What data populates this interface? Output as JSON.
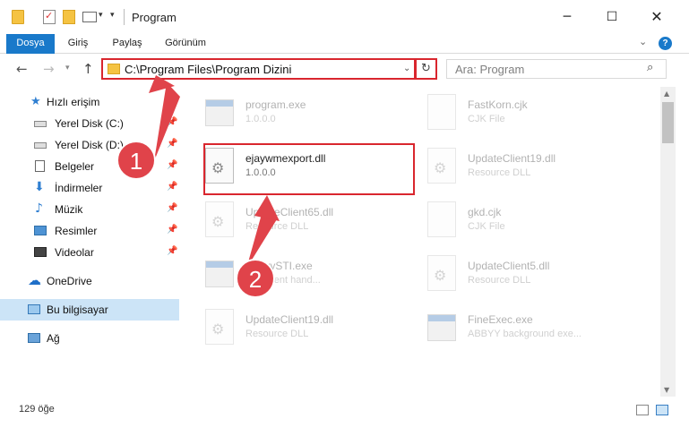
{
  "window": {
    "title": "Program",
    "minimize_glyph": "─",
    "maximize_glyph": "☐",
    "close_glyph": "✕"
  },
  "ribbon": {
    "tabs": [
      {
        "label": "Dosya",
        "active": true
      },
      {
        "label": "Giriş"
      },
      {
        "label": "Paylaş"
      },
      {
        "label": "Görünüm"
      }
    ],
    "help": "?"
  },
  "address": {
    "path": "C:\\Program Files\\Program Dizini",
    "search_placeholder": "Ara: Program"
  },
  "sidebar": {
    "items": [
      {
        "label": "Hızlı erişim",
        "icon": "star-icon"
      },
      {
        "label": "Yerel Disk (C:)",
        "icon": "disk-icon",
        "pinned": true
      },
      {
        "label": "Yerel Disk (D:)",
        "icon": "disk-icon",
        "pinned": true
      },
      {
        "label": "Belgeler",
        "icon": "document-icon",
        "pinned": true
      },
      {
        "label": "İndirmeler",
        "icon": "download-icon",
        "pinned": true
      },
      {
        "label": "Müzik",
        "icon": "music-icon",
        "pinned": true
      },
      {
        "label": "Resimler",
        "icon": "pictures-icon",
        "pinned": true
      },
      {
        "label": "Videolar",
        "icon": "videos-icon",
        "pinned": true
      },
      {
        "label": "OneDrive",
        "icon": "onedrive-icon"
      },
      {
        "label": "Bu bilgisayar",
        "icon": "computer-icon",
        "selected": true
      },
      {
        "label": "Ağ",
        "icon": "network-icon"
      }
    ]
  },
  "files": [
    {
      "name": "program.exe",
      "desc": "1.0.0.0",
      "type": "exe",
      "faded": true
    },
    {
      "name": "FastKorn.cjk",
      "desc": "CJK File",
      "type": "file",
      "faded": true
    },
    {
      "name": "ejaywmexport.dll",
      "desc": "1.0.0.0",
      "type": "dll",
      "faded": false
    },
    {
      "name": "UpdateClient19.dll",
      "desc": "Resource DLL",
      "type": "dll",
      "faded": true
    },
    {
      "name": "UpdateClient65.dll",
      "desc": "Resource DLL",
      "type": "dll",
      "faded": true
    },
    {
      "name": "gkd.cjk",
      "desc": "CJK File",
      "type": "file",
      "faded": true
    },
    {
      "name": "AbbyySTI.exe",
      "desc": "STI event hand...",
      "type": "exe",
      "faded": true
    },
    {
      "name": "UpdateClient5.dll",
      "desc": "Resource DLL",
      "type": "dll",
      "faded": true
    },
    {
      "name": "UpdateClient19.dll",
      "desc": "Resource DLL",
      "type": "dll",
      "faded": true
    },
    {
      "name": "FineExec.exe",
      "desc": "ABBYY background exe...",
      "type": "exe",
      "faded": true
    }
  ],
  "annotations": {
    "step1": "1",
    "step2": "2",
    "color": "#e0434a"
  },
  "status": {
    "item_count": "129 öğe"
  }
}
